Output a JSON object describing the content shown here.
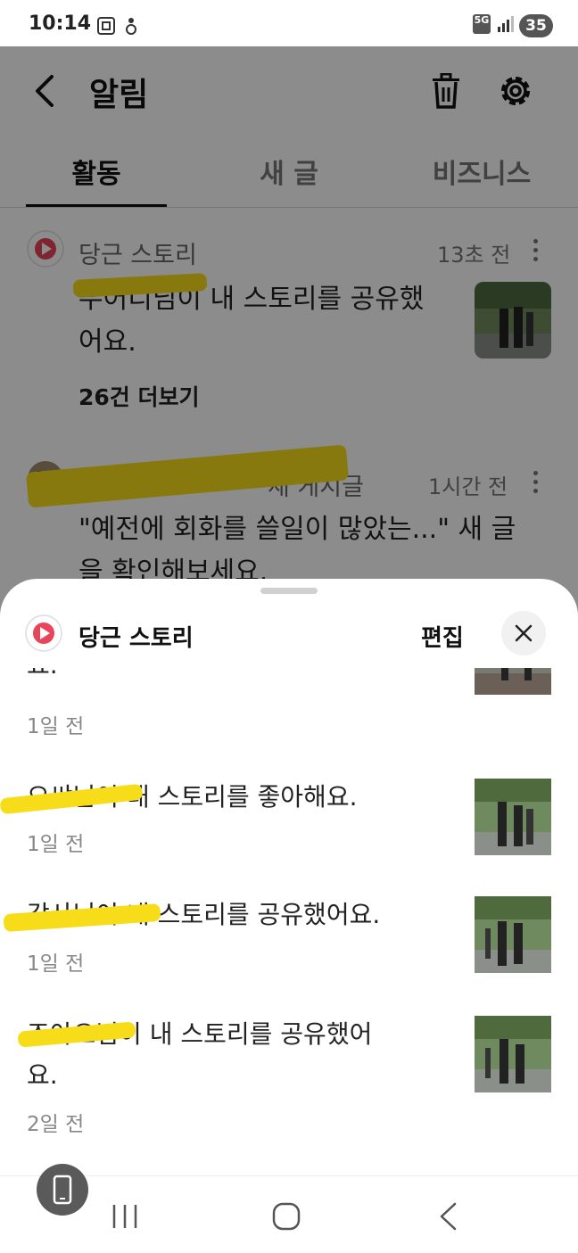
{
  "status_bar": {
    "time": "10:14",
    "network": "5G",
    "battery": "35"
  },
  "header": {
    "title": "알림",
    "back_icon": "chevron-left-icon",
    "trash_icon": "trash-icon",
    "settings_icon": "gear-icon"
  },
  "tabs": [
    {
      "label": "활동",
      "active": true
    },
    {
      "label": "새 글",
      "active": false
    },
    {
      "label": "비즈니스",
      "active": false
    }
  ],
  "notifications": [
    {
      "source": "당근 스토리",
      "time": "13초 전",
      "text_line1": "우어디님이 내 스토리를 공유했",
      "text_line2": "어요.",
      "more": "26건 더보기"
    },
    {
      "source": "새 게시글",
      "time": "1시간 전",
      "text_line1": "\"예전에 회화를 쓸일이 많았는...\" 새 글",
      "text_line2": "을 확인해보세요."
    }
  ],
  "sheet": {
    "title": "당근 스토리",
    "edit_label": "편집",
    "partial_text": "요.",
    "partial_time": "1일 전",
    "items": [
      {
        "text_line1": "으쌰님이 내 스토리를 좋아해요.",
        "text_line2": "",
        "time": "1일 전"
      },
      {
        "text_line1": "감사님이 내 스토리를 공유했어요.",
        "text_line2": "",
        "time": "1일 전"
      },
      {
        "text_line1": "조아요님이 내 스토리를 공유했어",
        "text_line2": "요.",
        "time": "2일 전"
      }
    ]
  },
  "colors": {
    "accent": "#e8445a",
    "scribble": "#f7dc1a",
    "dim": "rgba(0,0,0,0.45)"
  }
}
